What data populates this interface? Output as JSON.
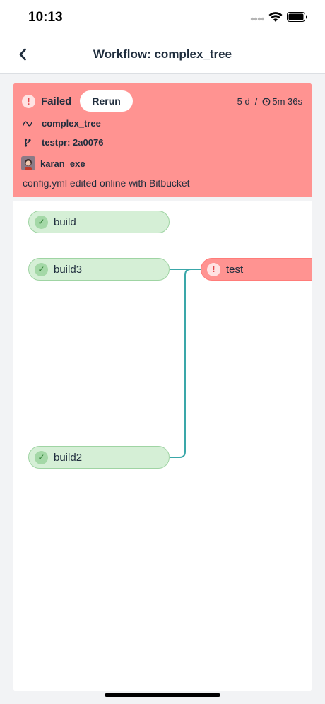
{
  "status_bar": {
    "time": "10:13"
  },
  "nav": {
    "title": "Workflow: complex_tree"
  },
  "summary": {
    "status": "Failed",
    "rerun_label": "Rerun",
    "age": "5 d",
    "separator": "/",
    "duration": "5m 36s",
    "workflow_name": "complex_tree",
    "branch": "testpr: 2a0076",
    "user": "karan_exe",
    "commit_message": "config.yml edited online with Bitbucket"
  },
  "jobs": [
    {
      "name": "build",
      "status": "success"
    },
    {
      "name": "build3",
      "status": "success"
    },
    {
      "name": "test",
      "status": "failed"
    },
    {
      "name": "build2",
      "status": "success"
    }
  ],
  "colors": {
    "failed_bg": "#ff9391",
    "success_bg": "#d5efd6",
    "edge": "#3aa7a9"
  },
  "icons": {
    "back": "chevron-left-icon",
    "failed": "exclamation-circle-icon",
    "success": "check-circle-icon",
    "workflow": "workflow-icon",
    "branch": "git-branch-icon",
    "clock": "clock-icon"
  }
}
